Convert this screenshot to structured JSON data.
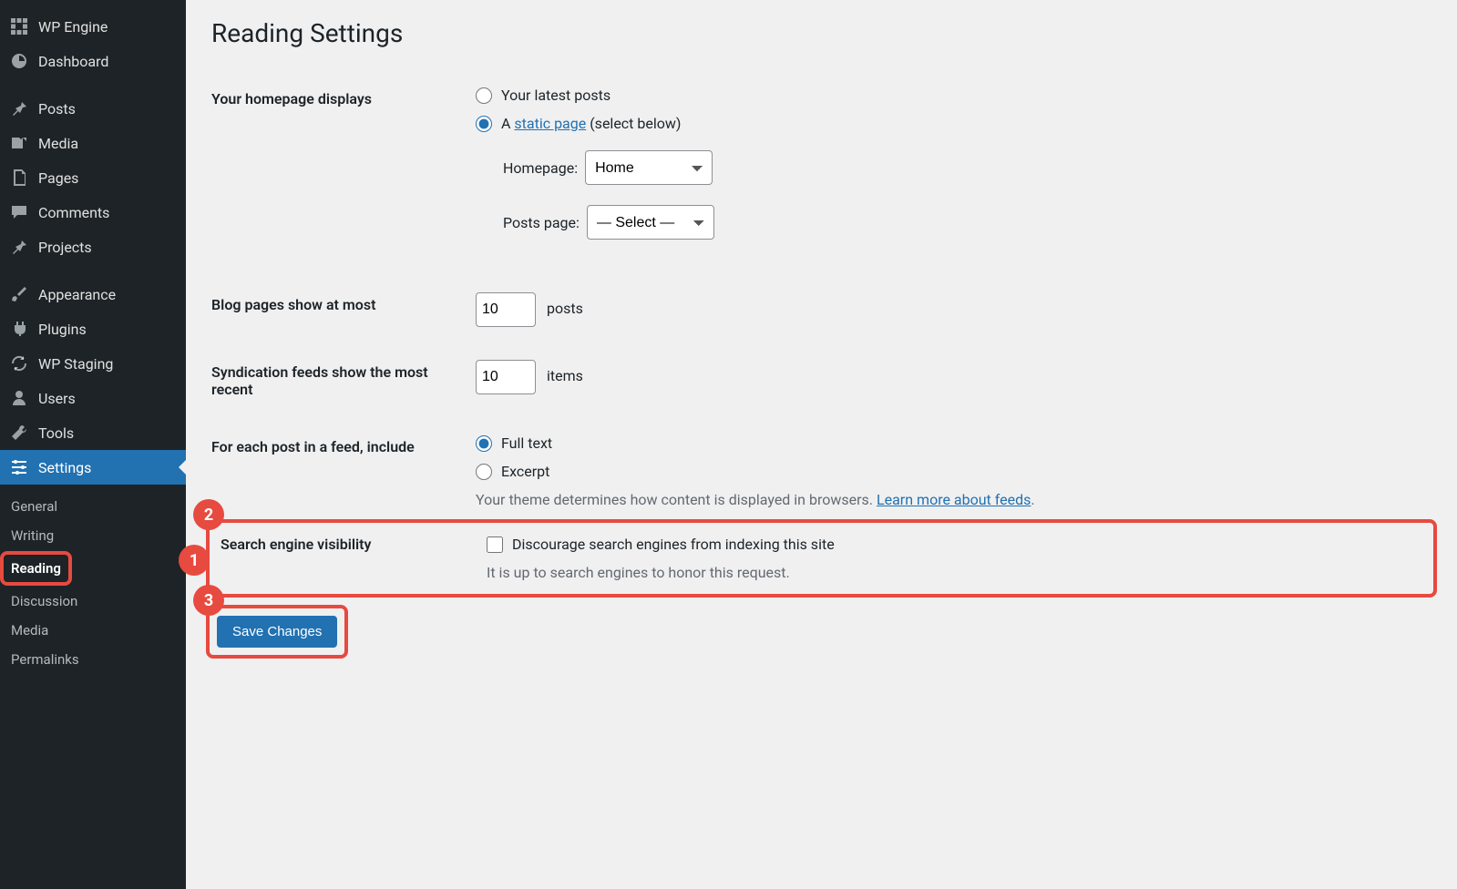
{
  "sidebar": {
    "items": [
      {
        "label": "WP Engine",
        "icon": "wpengine"
      },
      {
        "label": "Dashboard",
        "icon": "dashboard"
      },
      {
        "label": "Posts",
        "icon": "pin"
      },
      {
        "label": "Media",
        "icon": "media"
      },
      {
        "label": "Pages",
        "icon": "page"
      },
      {
        "label": "Comments",
        "icon": "comment"
      },
      {
        "label": "Projects",
        "icon": "pin"
      },
      {
        "label": "Appearance",
        "icon": "brush"
      },
      {
        "label": "Plugins",
        "icon": "plug"
      },
      {
        "label": "WP Staging",
        "icon": "refresh"
      },
      {
        "label": "Users",
        "icon": "user"
      },
      {
        "label": "Tools",
        "icon": "wrench"
      },
      {
        "label": "Settings",
        "icon": "sliders"
      }
    ],
    "settings_submenu": [
      {
        "label": "General"
      },
      {
        "label": "Writing"
      },
      {
        "label": "Reading"
      },
      {
        "label": "Discussion"
      },
      {
        "label": "Media"
      },
      {
        "label": "Permalinks"
      }
    ]
  },
  "page": {
    "title": "Reading Settings",
    "homepage_displays_label": "Your homepage displays",
    "opt_latest_posts": "Your latest posts",
    "opt_static_prefix": "A ",
    "opt_static_link": "static page",
    "opt_static_suffix": " (select below)",
    "homepage_label": "Homepage:",
    "homepage_value": "Home",
    "postspage_label": "Posts page:",
    "postspage_value": "— Select —",
    "blog_pages_label": "Blog pages show at most",
    "blog_pages_value": "10",
    "blog_pages_suffix": "posts",
    "synd_label": "Syndication feeds show the most recent",
    "synd_value": "10",
    "synd_suffix": "items",
    "feed_include_label": "For each post in a feed, include",
    "feed_full": "Full text",
    "feed_excerpt": "Excerpt",
    "feed_desc_prefix": "Your theme determines how content is displayed in browsers. ",
    "feed_desc_link": "Learn more about feeds",
    "feed_desc_suffix": ".",
    "sev_label": "Search engine visibility",
    "sev_checkbox": "Discourage search engines from indexing this site",
    "sev_desc": "It is up to search engines to honor this request.",
    "save_label": "Save Changes"
  },
  "annotations": {
    "b1": "1",
    "b2": "2",
    "b3": "3"
  }
}
